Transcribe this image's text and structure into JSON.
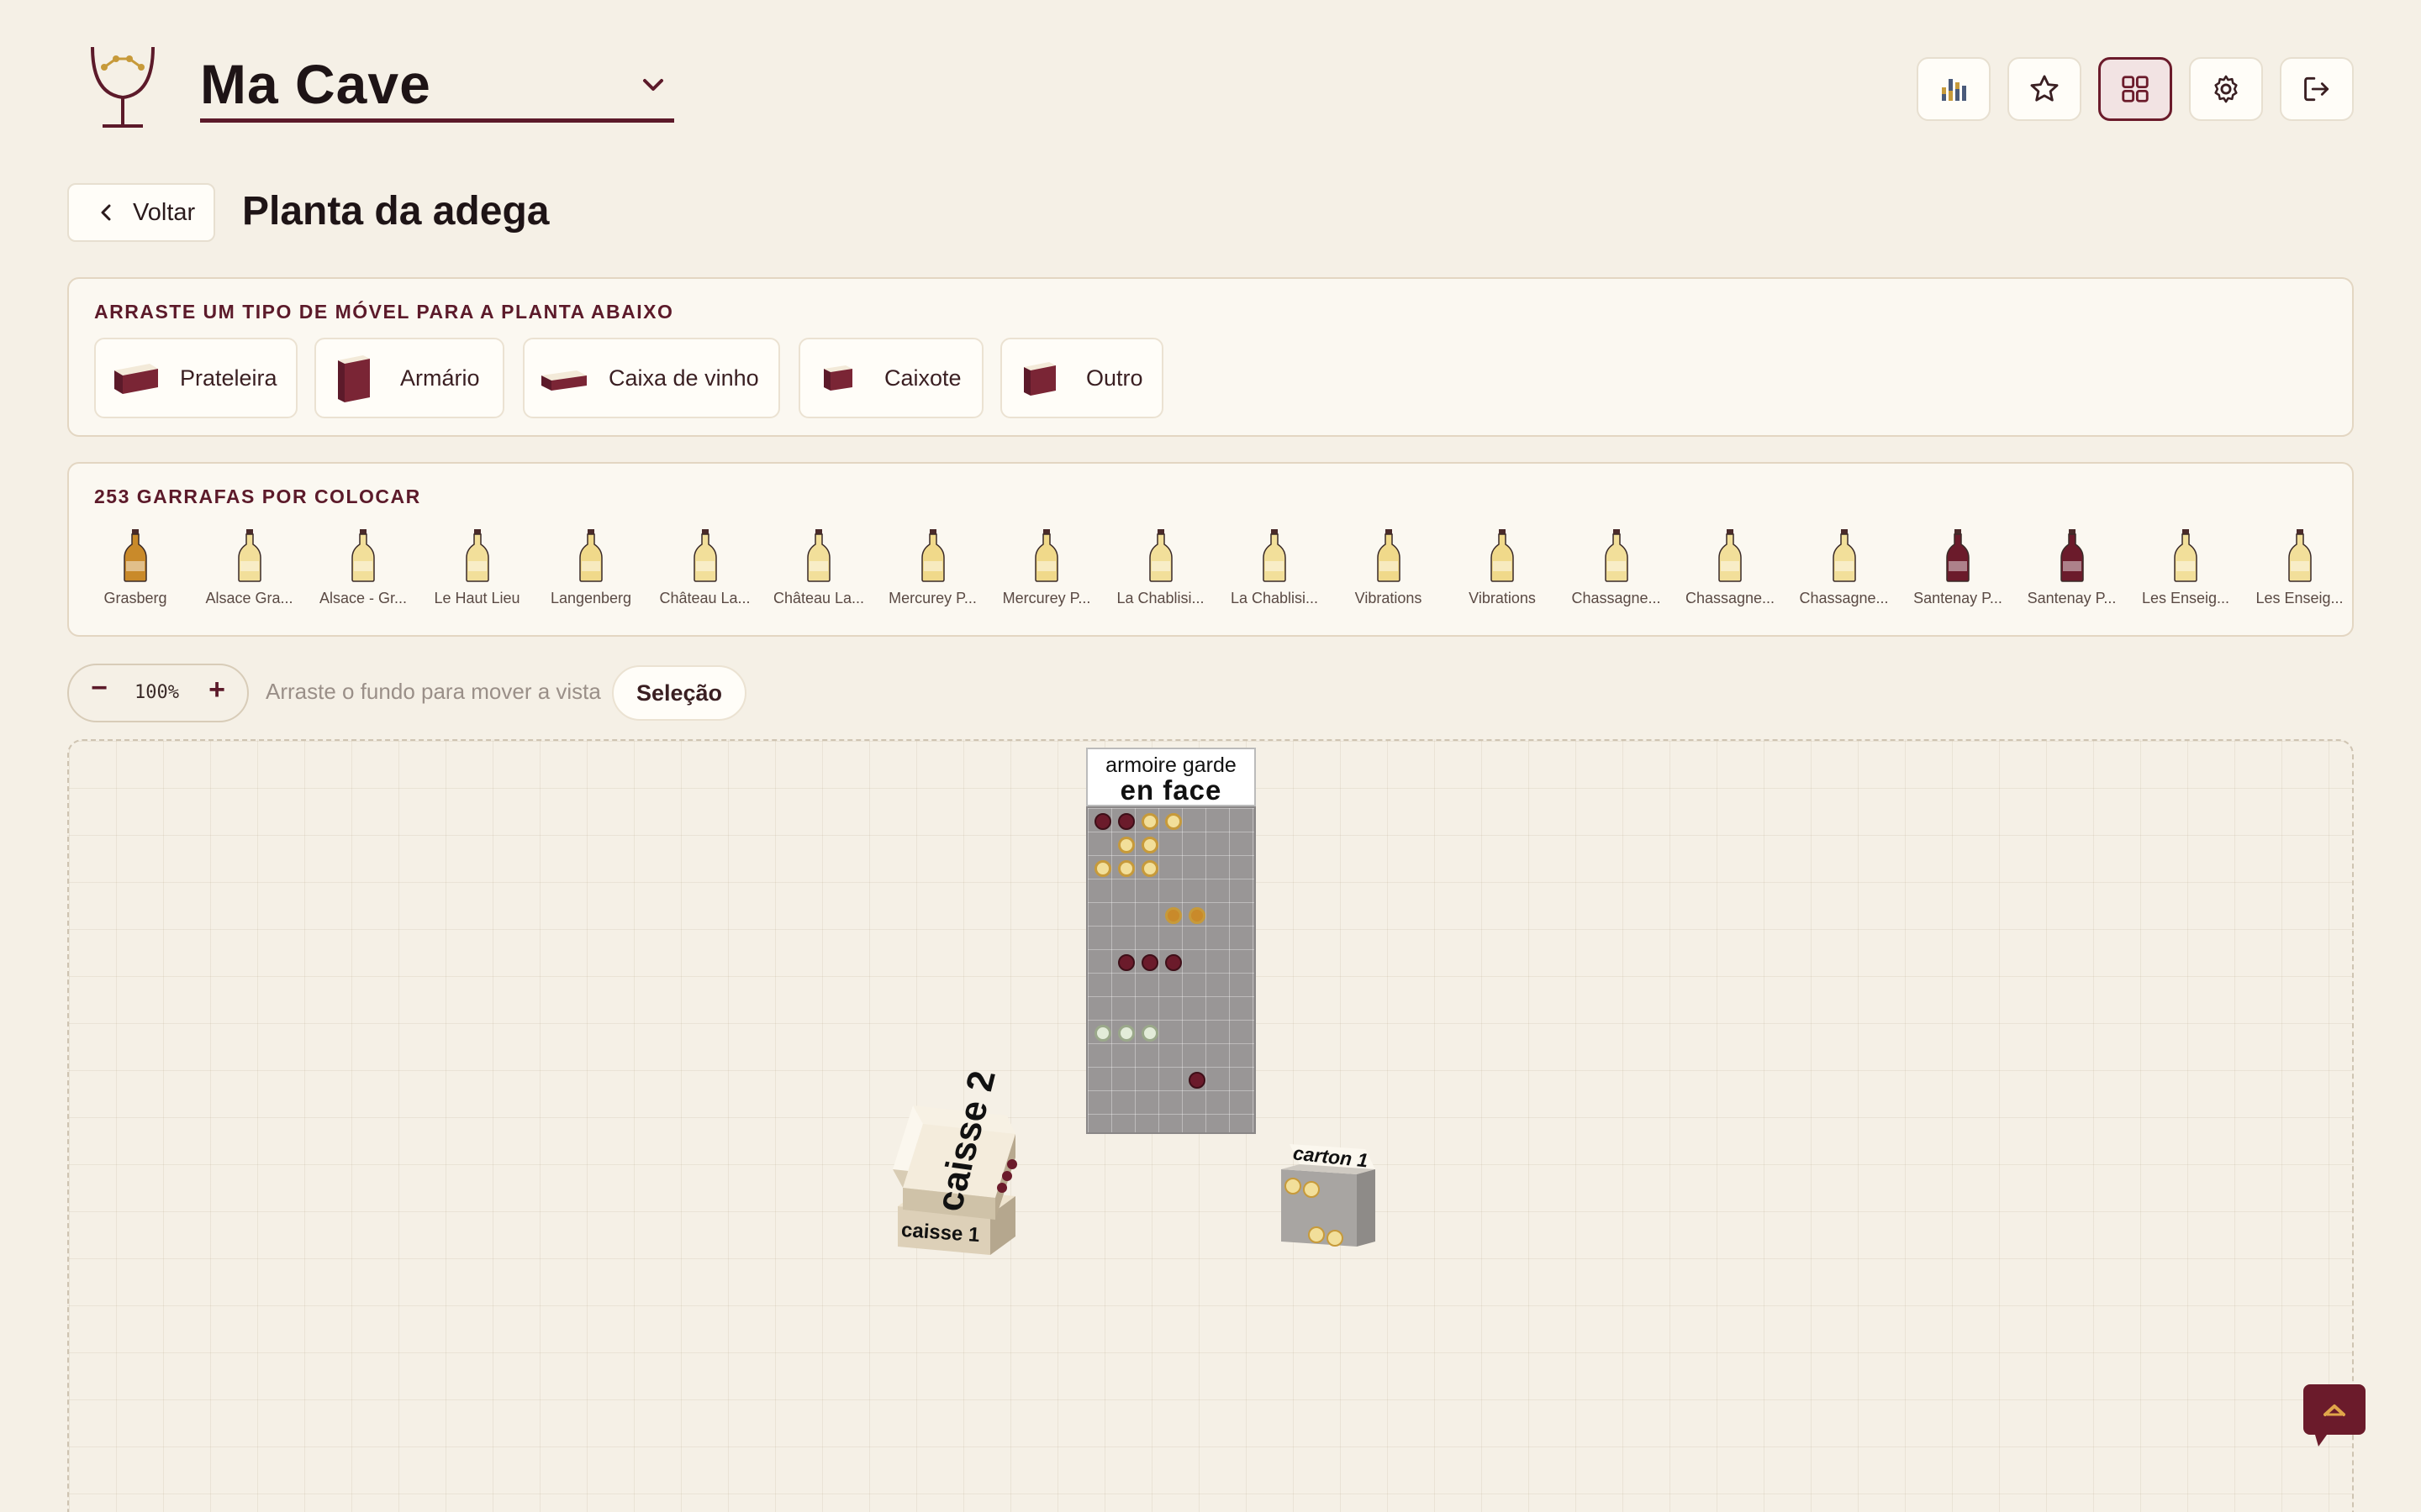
{
  "header": {
    "cellar_name": "Ma Cave",
    "icons": [
      "stats-icon",
      "star-icon",
      "grid-icon",
      "gear-icon",
      "logout-icon"
    ]
  },
  "nav": {
    "back_label": "Voltar",
    "page_title": "Planta da adega"
  },
  "furniture_panel": {
    "label": "ARRASTE UM TIPO DE MÓVEL PARA A PLANTA ABAIXO",
    "items": [
      {
        "label": "Prateleira"
      },
      {
        "label": "Armário"
      },
      {
        "label": "Caixa de vinho"
      },
      {
        "label": "Caixote"
      },
      {
        "label": "Outro"
      }
    ]
  },
  "bottles_panel": {
    "label": "253 GARRAFAS POR COLOCAR",
    "bottles": [
      {
        "name": "Grasberg",
        "color": "#c98a2a"
      },
      {
        "name": "Alsace Gra...",
        "color": "#f2df9a"
      },
      {
        "name": "Alsace - Gr...",
        "color": "#f2df9a"
      },
      {
        "name": "Le Haut Lieu",
        "color": "#f2df9a"
      },
      {
        "name": "Langenberg",
        "color": "#f0d98a"
      },
      {
        "name": "Château La...",
        "color": "#f2df9a"
      },
      {
        "name": "Château La...",
        "color": "#f2df9a"
      },
      {
        "name": "Mercurey P...",
        "color": "#f0d98a"
      },
      {
        "name": "Mercurey P...",
        "color": "#f0d98a"
      },
      {
        "name": "La Chablisi...",
        "color": "#f2df9a"
      },
      {
        "name": "La Chablisi...",
        "color": "#f2df9a"
      },
      {
        "name": "Vibrations",
        "color": "#f0d98a"
      },
      {
        "name": "Vibrations",
        "color": "#f0d98a"
      },
      {
        "name": "Chassagne...",
        "color": "#f2df9a"
      },
      {
        "name": "Chassagne...",
        "color": "#f2df9a"
      },
      {
        "name": "Chassagne...",
        "color": "#f2df9a"
      },
      {
        "name": "Santenay P...",
        "color": "#6b1b2b"
      },
      {
        "name": "Santenay P...",
        "color": "#6b1b2b"
      },
      {
        "name": "Les Enseig...",
        "color": "#f2df9a"
      },
      {
        "name": "Les Enseig...",
        "color": "#f2df9a"
      }
    ]
  },
  "toolbar": {
    "zoom_minus": "−",
    "zoom_value": "100%",
    "zoom_plus": "+",
    "hint": "Arraste o fundo para mover a vista",
    "selection_label": "Seleção"
  },
  "plan": {
    "armoire": {
      "title_line1": "armoire garde",
      "title_line2": "en face"
    },
    "caisse2": {
      "label": "caisse 2"
    },
    "caisse1": {
      "label": "caisse 1"
    },
    "carton1": {
      "label": "carton 1"
    }
  },
  "colors": {
    "accent": "#6b1b2b",
    "background": "#f5f0e6",
    "red_wine": "#6b1b2b",
    "white_wine": "#f2df9a",
    "amber_wine": "#c98a2a"
  }
}
